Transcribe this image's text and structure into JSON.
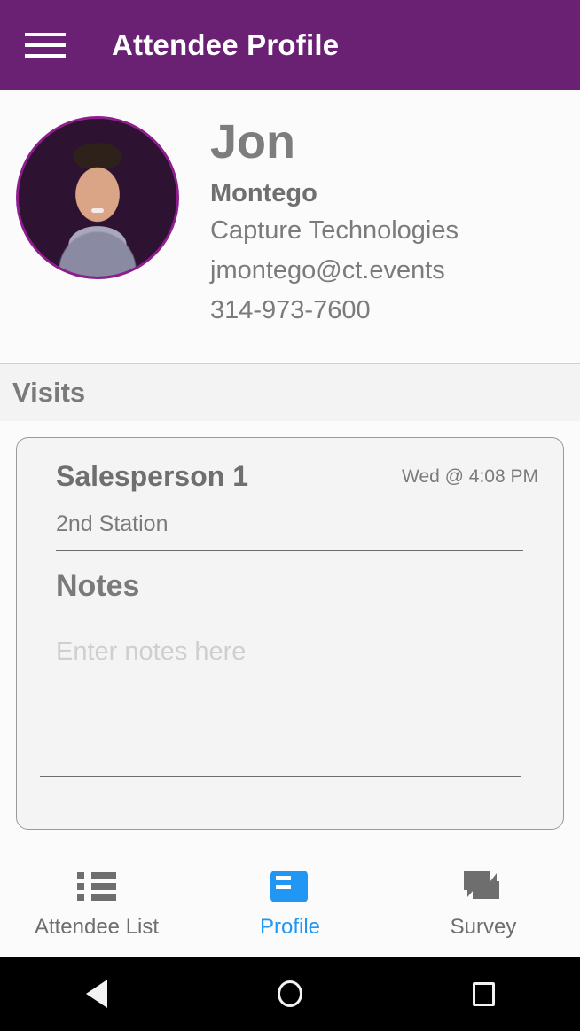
{
  "appbar": {
    "menu_icon": "hamburger-menu-icon",
    "title": "Attendee Profile"
  },
  "profile": {
    "avatar_alt": "attendee-photo",
    "first_name": "Jon",
    "last_name": "Montego",
    "company": "Capture Technologies",
    "email": "jmontego@ct.events",
    "phone": "314-973-7600"
  },
  "visits": {
    "section_title": "Visits",
    "cards": [
      {
        "salesperson": "Salesperson 1",
        "timestamp": "Wed @ 4:08 PM",
        "station": "2nd Station",
        "notes_title": "Notes",
        "notes_value": "",
        "notes_placeholder": "Enter notes here"
      }
    ]
  },
  "tabbar": {
    "active": "Profile",
    "tabs": [
      {
        "label": "Attendee List",
        "icon": "list-icon",
        "active": false
      },
      {
        "label": "Profile",
        "icon": "contact-card-icon",
        "active": true
      },
      {
        "label": "Survey",
        "icon": "forum-icon",
        "active": false
      }
    ]
  },
  "system_nav": {
    "back": "back-triangle-icon",
    "home": "home-circle-icon",
    "recents": "recents-square-icon"
  },
  "colors": {
    "appbar_purple": "#6b2173",
    "avatar_ring": "#8e1d8e",
    "accent_blue": "#2196f3",
    "text_gray": "#7b7b7b",
    "placeholder_gray": "#cfcfcf"
  }
}
